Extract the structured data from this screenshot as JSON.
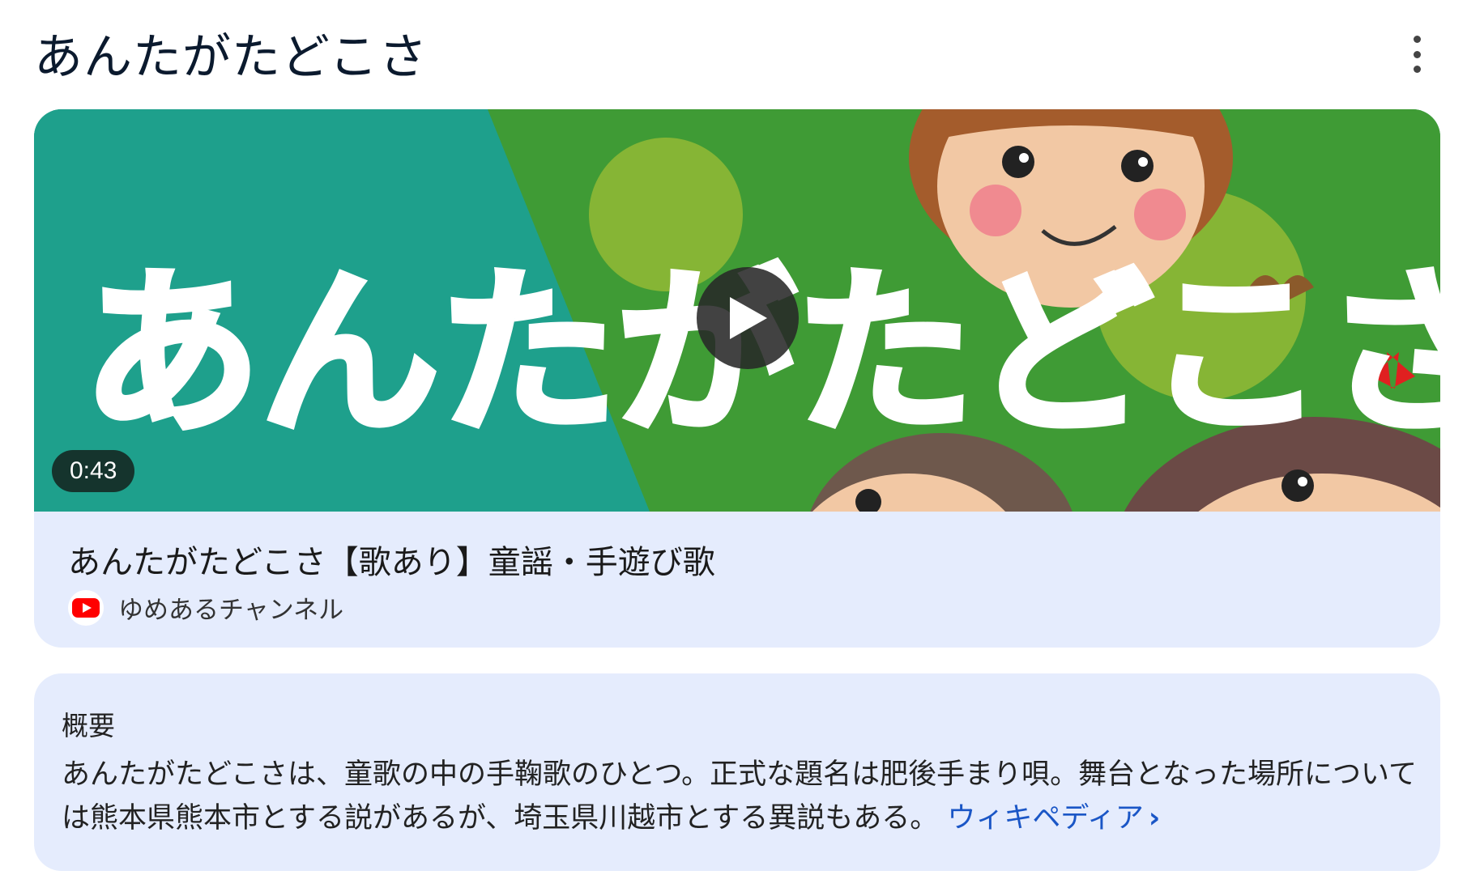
{
  "page": {
    "title": "あんたがたどこさ"
  },
  "video": {
    "duration": "0:43",
    "title": "あんたがたどこさ【歌あり】童謡・手遊び歌",
    "channel": "ゆめあるチャンネル",
    "thumbnail_text": "あんたがたどこさ"
  },
  "summary": {
    "heading": "概要",
    "text": "あんたがたどこさは、童歌の中の手鞠歌のひとつ。正式な題名は肥後手まり唄。舞台となった場所については熊本県熊本市とする説があるが、埼玉県川越市とする異説もある。",
    "link_label": "ウィキペディア",
    "link_chevron": "›"
  },
  "colors": {
    "accent_link": "#1a56c6",
    "card_bg": "#e5ecfd",
    "youtube_red": "#ff0000"
  },
  "icons": {
    "more": "more-vert-icon",
    "play": "play-icon",
    "channel": "youtube-icon"
  }
}
